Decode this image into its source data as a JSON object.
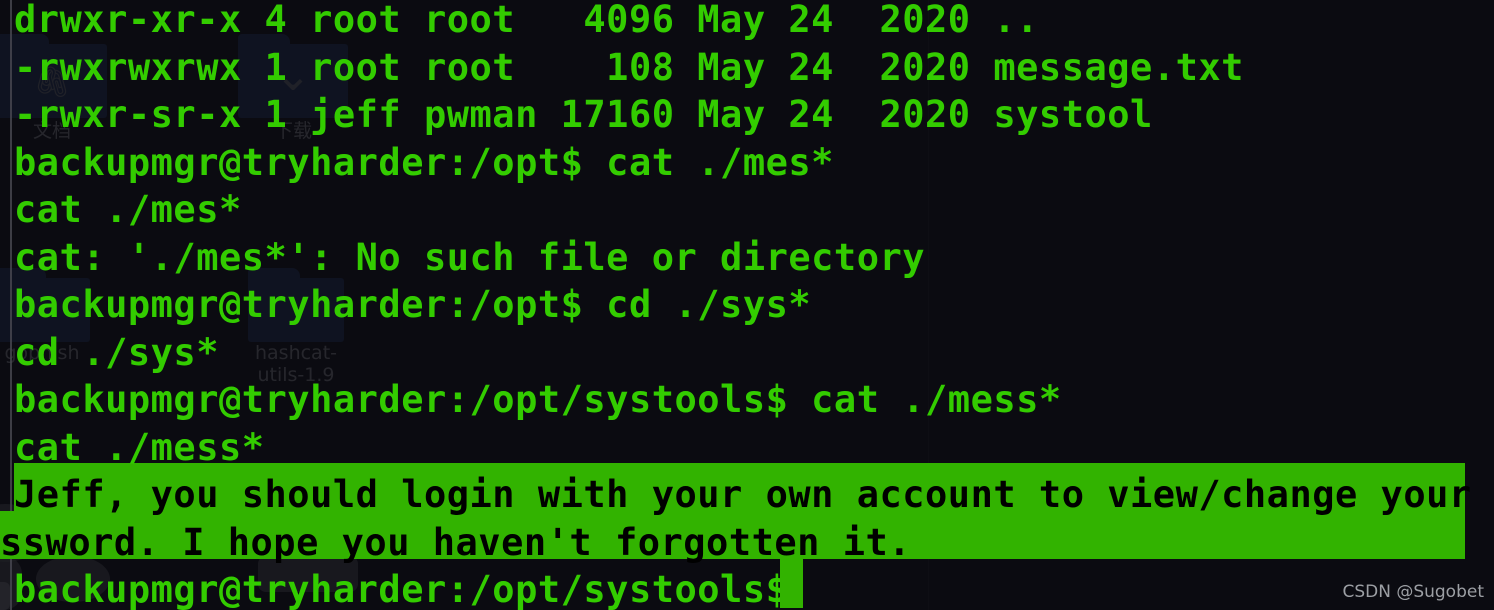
{
  "terminal": {
    "background_color": "#0a0a10",
    "text_color": "#33cc00",
    "highlight_background": "#32b300",
    "highlight_text_color": "#000000",
    "cursor_color": "#32b300",
    "lines": [
      {
        "text": "drwxr-xr-x 4 root root   4096 May 24  2020 ..",
        "highlight": false
      },
      {
        "text": "-rwxrwxrwx 1 root root    108 May 24  2020 message.txt",
        "highlight": false
      },
      {
        "text": "-rwxr-sr-x 1 jeff pwman 17160 May 24  2020 systool",
        "highlight": false
      },
      {
        "text": "backupmgr@tryharder:/opt$ cat ./mes*",
        "highlight": false
      },
      {
        "text": "cat ./mes*",
        "highlight": false
      },
      {
        "text": "cat: './mes*': No such file or directory",
        "highlight": false
      },
      {
        "text": "backupmgr@tryharder:/opt$ cd ./sys*",
        "highlight": false
      },
      {
        "text": "cd ./sys*",
        "highlight": false
      },
      {
        "text": "backupmgr@tryharder:/opt/systools$ cat ./mess*",
        "highlight": false
      },
      {
        "text": "cat ./mess*",
        "highlight": false
      },
      {
        "text": "Jeff, you should login with your own account to view/change your pa",
        "highlight": true
      },
      {
        "text": "ssword. I hope you haven't forgotten it.",
        "highlight": true
      },
      {
        "text": "backupmgr@tryharder:/opt/systools$",
        "highlight": false
      }
    ]
  },
  "desktop": {
    "icons": [
      {
        "label": "文档",
        "icon": "folder-documents-icon",
        "glyph": "🖇"
      },
      {
        "label": "下载",
        "icon": "folder-downloads-icon",
        "glyph": "⌄"
      },
      {
        "label": "gophish",
        "icon": "folder-icon",
        "glyph": ""
      },
      {
        "label": "hashcat-\nutils-1.9",
        "icon": "folder-icon",
        "glyph": ""
      }
    ]
  },
  "watermark": {
    "text": "CSDN @Sugobet"
  }
}
